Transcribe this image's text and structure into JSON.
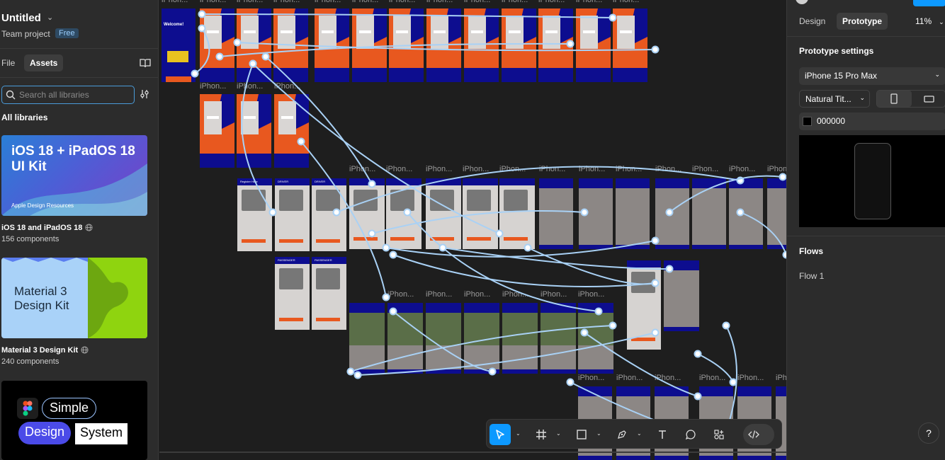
{
  "header": {
    "project_title": "Untitled",
    "team_label": "Team project",
    "plan_badge": "Free"
  },
  "left_tabs": {
    "file": "File",
    "assets": "Assets"
  },
  "search": {
    "placeholder": "Search all libraries"
  },
  "libraries": {
    "heading": "All libraries",
    "items": [
      {
        "name": "iOS 18 and iPadOS 18",
        "count": "156 components",
        "thumb_title": "iOS 18 + iPadOS 18 UI Kit",
        "thumb_footer": "Apple Design Resources"
      },
      {
        "name": "Material 3 Design Kit",
        "count": "240 components",
        "thumb_title": "Material 3 Design Kit"
      },
      {
        "thumb_words": [
          "Simple",
          "Design",
          "System"
        ]
      }
    ]
  },
  "canvas": {
    "frame_label": "iPhon...",
    "screen_texts": {
      "welcome": "Welcome!",
      "register": "Register Here",
      "driver": "DRIVER",
      "passenger": "PASSENGER"
    }
  },
  "right_tabs": {
    "design": "Design",
    "prototype": "Prototype",
    "zoom": "11%"
  },
  "prototype_settings": {
    "title": "Prototype settings",
    "device": "iPhone 15 Pro Max",
    "model_select": "Natural Tit...",
    "background_hex": "000000",
    "background_color": "#000000"
  },
  "flows": {
    "title": "Flows",
    "items": [
      "Flow 1"
    ]
  },
  "help": "?",
  "colors": {
    "accent": "#0d99ff",
    "orange": "#e8581f",
    "navy": "#0d0d8f",
    "flow_line": "#a9d1f5"
  }
}
